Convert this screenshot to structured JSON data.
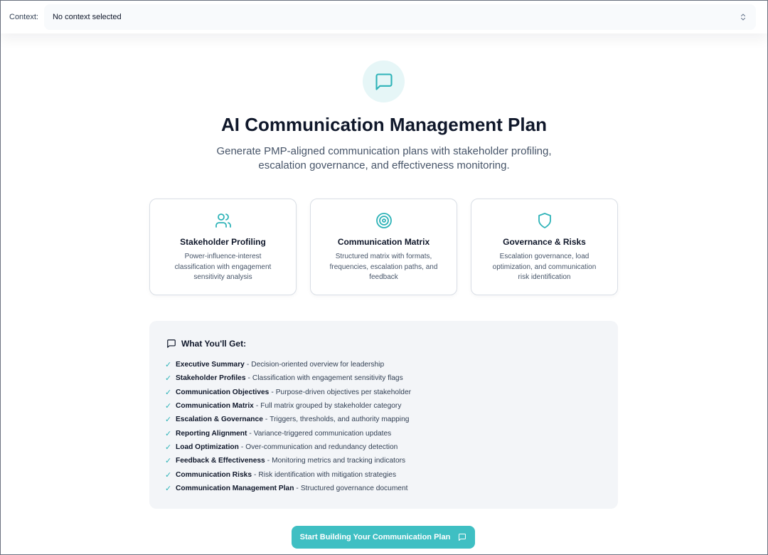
{
  "context": {
    "label": "Context:",
    "value": "No context selected"
  },
  "hero": {
    "icon": "message-square-icon",
    "title": "AI Communication Management Plan",
    "subtitle": "Generate PMP-aligned communication plans with stakeholder profiling, escalation governance, and effectiveness monitoring."
  },
  "features": [
    {
      "icon": "users-icon",
      "title": "Stakeholder Profiling",
      "description": "Power-influence-interest classification with engagement sensitivity analysis"
    },
    {
      "icon": "target-icon",
      "title": "Communication Matrix",
      "description": "Structured matrix with formats, frequencies, escalation paths, and feedback"
    },
    {
      "icon": "shield-icon",
      "title": "Governance & Risks",
      "description": "Escalation governance, load optimization, and communication risk identification"
    }
  ],
  "deliverables": {
    "heading": "What You'll Get:",
    "check": "✓",
    "separator": "-",
    "items": [
      {
        "name": "Executive Summary",
        "desc": "Decision-oriented overview for leadership"
      },
      {
        "name": "Stakeholder Profiles",
        "desc": "Classification with engagement sensitivity flags"
      },
      {
        "name": "Communication Objectives",
        "desc": "Purpose-driven objectives per stakeholder"
      },
      {
        "name": "Communication Matrix",
        "desc": "Full matrix grouped by stakeholder category"
      },
      {
        "name": "Escalation & Governance",
        "desc": "Triggers, thresholds, and authority mapping"
      },
      {
        "name": "Reporting Alignment",
        "desc": "Variance-triggered communication updates"
      },
      {
        "name": "Load Optimization",
        "desc": "Over-communication and redundancy detection"
      },
      {
        "name": "Feedback & Effectiveness",
        "desc": "Monitoring metrics and tracking indicators"
      },
      {
        "name": "Communication Risks",
        "desc": "Risk identification with mitigation strategies"
      },
      {
        "name": "Communication Management Plan",
        "desc": "Structured governance document"
      }
    ]
  },
  "cta": {
    "label": "Start Building Your Communication Plan"
  },
  "colors": {
    "accent": "#3fbfc3",
    "accent_soft": "#e6f6f7"
  }
}
